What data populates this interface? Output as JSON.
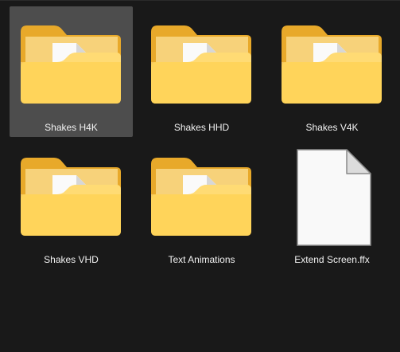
{
  "items": [
    {
      "label": "Shakes H4K",
      "icon": "folder-icon",
      "selected": true
    },
    {
      "label": "Shakes HHD",
      "icon": "folder-icon",
      "selected": false
    },
    {
      "label": "Shakes V4K",
      "icon": "folder-icon",
      "selected": false
    },
    {
      "label": "Shakes VHD",
      "icon": "folder-icon",
      "selected": false
    },
    {
      "label": "Text Animations",
      "icon": "folder-icon",
      "selected": false
    },
    {
      "label": "Extend Screen.ffx",
      "icon": "file-icon",
      "selected": false
    }
  ],
  "colors": {
    "background": "#191919",
    "selection": "#4d4d4d",
    "folder_back": "#f0b429",
    "folder_front": "#ffd766",
    "text": "#f2f2f2"
  }
}
